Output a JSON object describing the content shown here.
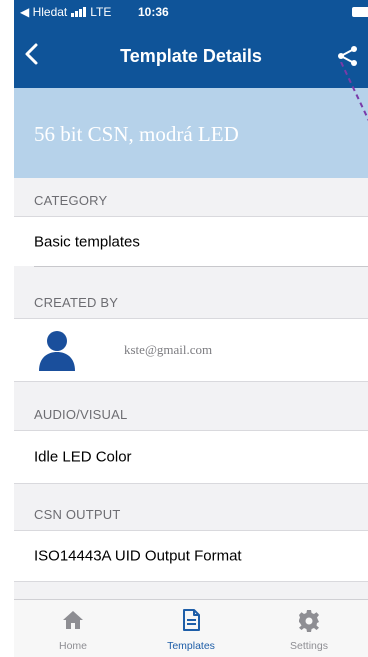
{
  "status_bar": {
    "back_app": "◀ Hledat",
    "network": "LTE",
    "time": "10:36"
  },
  "nav": {
    "title": "Template Details"
  },
  "template": {
    "name": "56 bit CSN, modrá LED"
  },
  "sections": {
    "category": {
      "header": "CATEGORY",
      "value": "Basic templates"
    },
    "created_by": {
      "header": "CREATED BY",
      "email": "kste@gmail.com"
    },
    "audio_visual": {
      "header": "AUDIO/VISUAL",
      "value": "Idle LED Color"
    },
    "csn_output": {
      "header": "CSN OUTPUT",
      "value": "ISO14443A UID Output Format"
    }
  },
  "tabs": [
    {
      "label": "Home",
      "icon": "home-icon",
      "active": false
    },
    {
      "label": "Templates",
      "icon": "document-icon",
      "active": true
    },
    {
      "label": "Settings",
      "icon": "gear-icon",
      "active": false
    }
  ],
  "colors": {
    "nav_blue": "#0f5499",
    "header_band": "#b6d2ea",
    "active_tab": "#1e5ea8",
    "avatar_blue": "#1a4f9c",
    "annotation_dash": "#7a3aa8"
  }
}
